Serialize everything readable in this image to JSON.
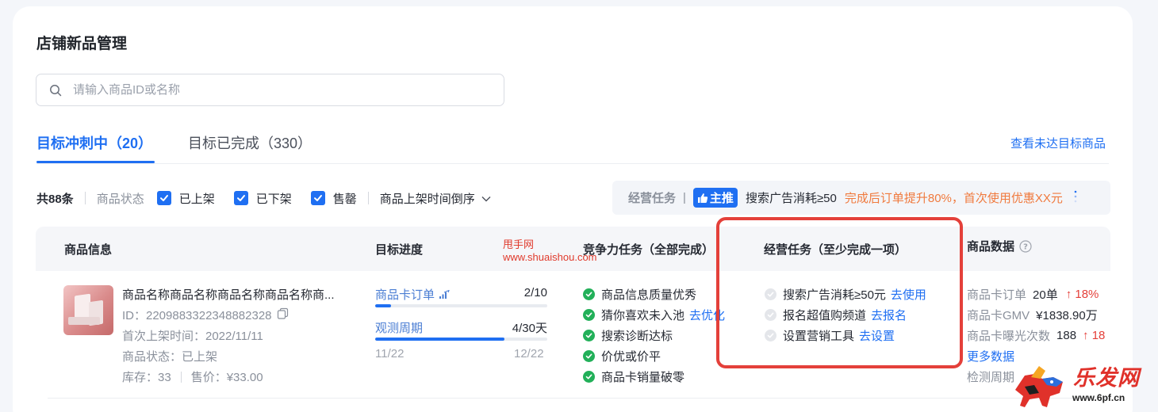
{
  "page": {
    "title": "店铺新品管理"
  },
  "search": {
    "placeholder": "请输入商品ID或名称"
  },
  "tabs": [
    {
      "label": "目标冲刺中（20）",
      "active": true
    },
    {
      "label": "目标已完成（330）",
      "active": false
    }
  ],
  "links": {
    "unmet": "查看未达目标商品"
  },
  "filters": {
    "total": "共88条",
    "status_label": "商品状态",
    "options": [
      {
        "label": "已上架",
        "checked": true
      },
      {
        "label": "已下架",
        "checked": true
      },
      {
        "label": "售罄",
        "checked": true
      }
    ],
    "sort": "商品上架时间倒序"
  },
  "op_banner": {
    "title": "经营任务",
    "bar": "|",
    "badge": "主推",
    "task": "搜索广告消耗≥50",
    "promo": "完成后订单提升80%，首次使用优惠XX元"
  },
  "table": {
    "headers": {
      "info": "商品信息",
      "progress": "目标进度",
      "competition": "竞争力任务（全部完成）",
      "operation": "经营任务（至少完成一项）",
      "data": "商品数据"
    }
  },
  "watermark": {
    "line1": "甩手网",
    "line2": "www.shuaishou.com"
  },
  "product": {
    "name": "商品名称商品名称商品名称商品名称商...",
    "id": "ID：2209883322348882328",
    "listed": "首次上架时间：2022/11/11",
    "status": "商品状态：已上架",
    "stock": "库存：33",
    "price": "售价：¥33.00"
  },
  "progress": {
    "order_label": "商品卡订单",
    "order_value": "2/10",
    "order_fraction": 0.09,
    "cycle_label": "观测周期",
    "cycle_value": "4/30天",
    "cycle_fraction": 0.75,
    "start_date": "11/22",
    "end_date": "12/22"
  },
  "competition": [
    {
      "label": "商品信息质量优秀",
      "done": true,
      "link": ""
    },
    {
      "label": "猜你喜欢未入池",
      "done": true,
      "link": "去优化"
    },
    {
      "label": "搜索诊断达标",
      "done": true,
      "link": ""
    },
    {
      "label": "价优或价平",
      "done": true,
      "link": ""
    },
    {
      "label": "商品卡销量破零",
      "done": true,
      "link": ""
    }
  ],
  "operation": [
    {
      "label": "搜索广告消耗≥50元",
      "link": "去使用"
    },
    {
      "label": "报名超值购频道",
      "link": "去报名"
    },
    {
      "label": "设置营销工具",
      "link": "去设置"
    }
  ],
  "stats": [
    {
      "key": "商品卡订单",
      "value": "20单",
      "change": "↑ 18%"
    },
    {
      "key": "商品卡GMV",
      "value": "¥1838.90万",
      "change": ""
    },
    {
      "key": "商品卡曝光次数",
      "value": "188",
      "change": "↑ 18"
    }
  ],
  "more_data": "更多数据",
  "check_cycle": "检测周期",
  "logo": {
    "text": "乐发网",
    "url": "www.6pf.cn"
  },
  "colors": {
    "accent": "#1f6ff2",
    "success": "#22b059",
    "alert": "#e4403a",
    "promo": "#f07a3e"
  }
}
